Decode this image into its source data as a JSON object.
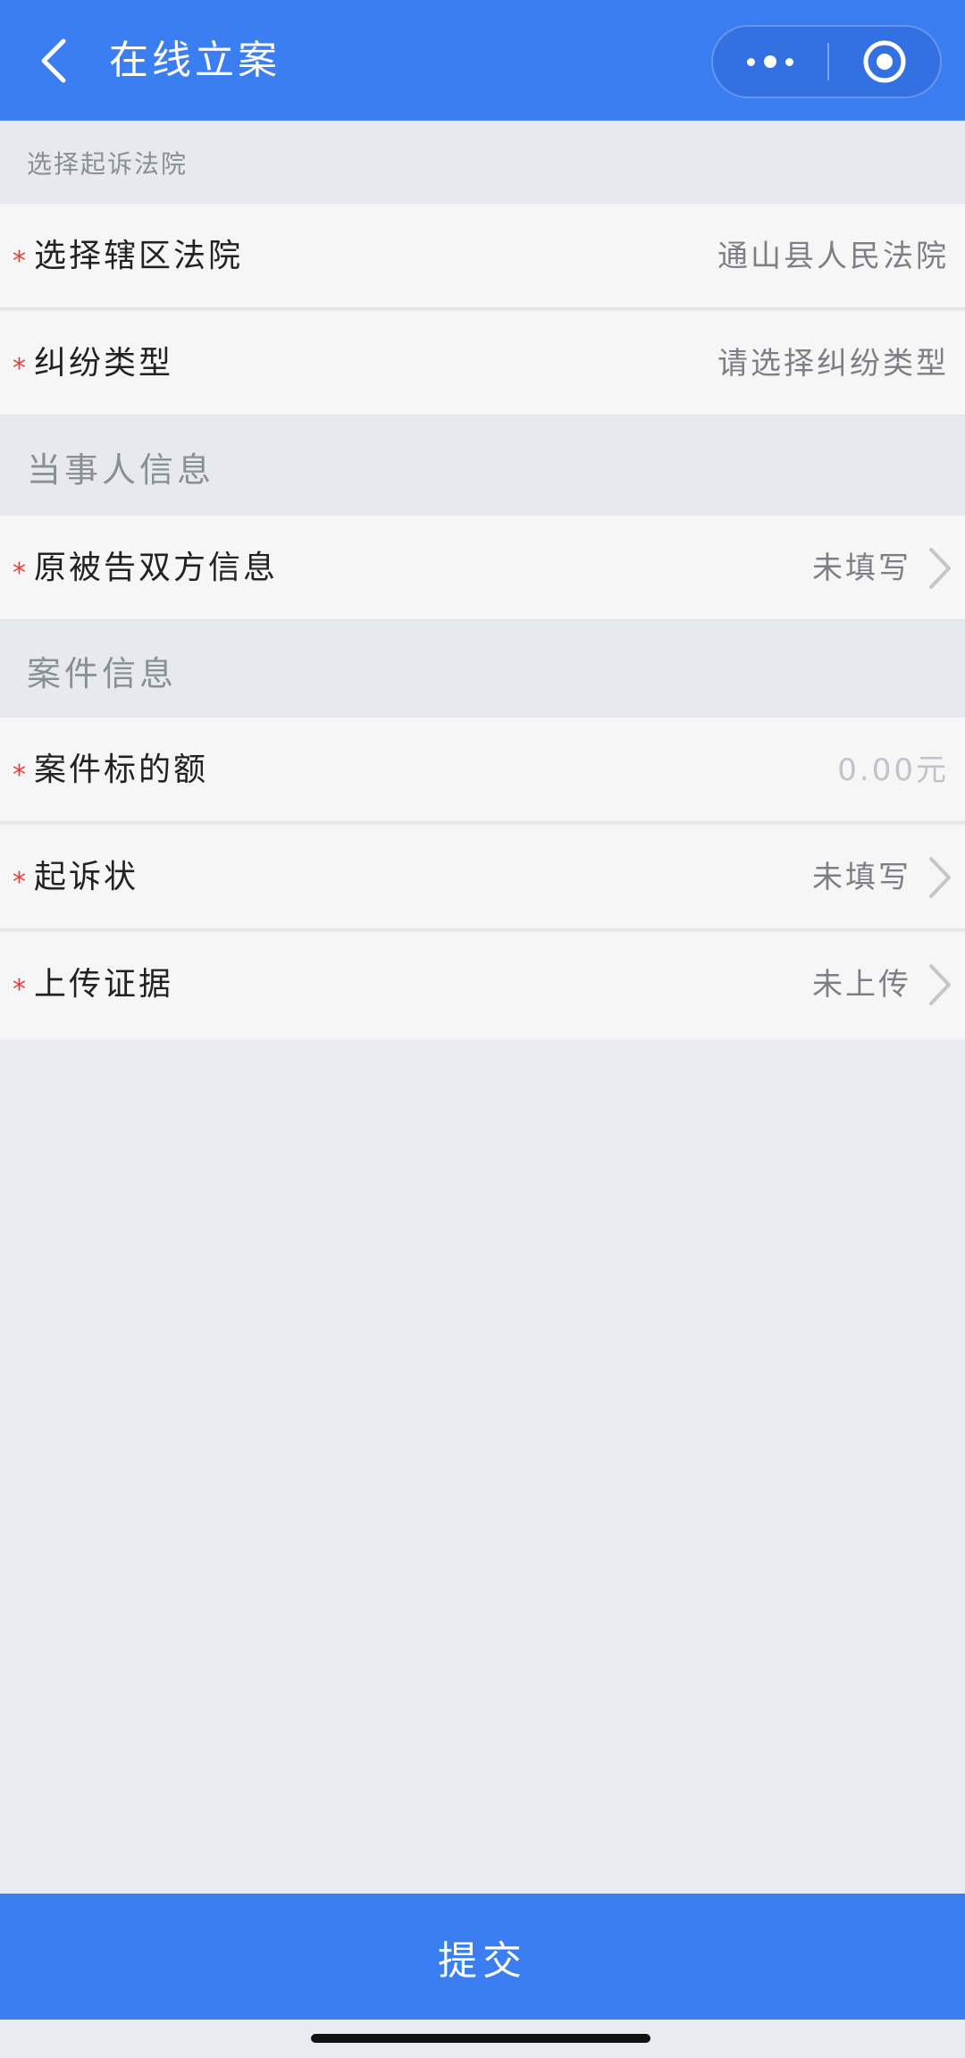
{
  "navbar": {
    "title": "在线立案",
    "back_icon": "chevron-left-icon",
    "more_icon": "more-dots-icon",
    "close_icon": "target-close-icon"
  },
  "sections": {
    "court": "选择起诉法院",
    "party": "当事人信息",
    "case": "案件信息"
  },
  "rows": {
    "court": {
      "required": "*",
      "label": "选择辖区法院",
      "value": "通山县人民法院"
    },
    "dispute": {
      "required": "*",
      "label": "纠纷类型",
      "value": "请选择纠纷类型"
    },
    "parties": {
      "required": "*",
      "label": "原被告双方信息",
      "value": "未填写"
    },
    "amount": {
      "required": "*",
      "label": "案件标的额",
      "value": "0.00元"
    },
    "complaint": {
      "required": "*",
      "label": "起诉状",
      "value": "未填写"
    },
    "evidence": {
      "required": "*",
      "label": "上传证据",
      "value": "未上传"
    }
  },
  "submit_label": "提交",
  "colors": {
    "primary": "#3a7ef2",
    "required": "#e0413a",
    "background": "#e8ebf0",
    "row_background": "#f6f6f6"
  }
}
